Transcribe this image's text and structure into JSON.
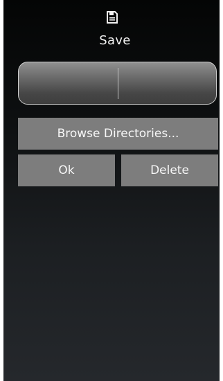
{
  "dialog": {
    "title": "Save",
    "icon": "floppy-disk-icon"
  },
  "filename_field": {
    "value": ""
  },
  "buttons": {
    "browse_label": "Browse Directories...",
    "ok_label": "Ok",
    "delete_label": "Delete"
  },
  "colors": {
    "button_bg": "#7d7d7d",
    "text": "#f2f2f2"
  }
}
